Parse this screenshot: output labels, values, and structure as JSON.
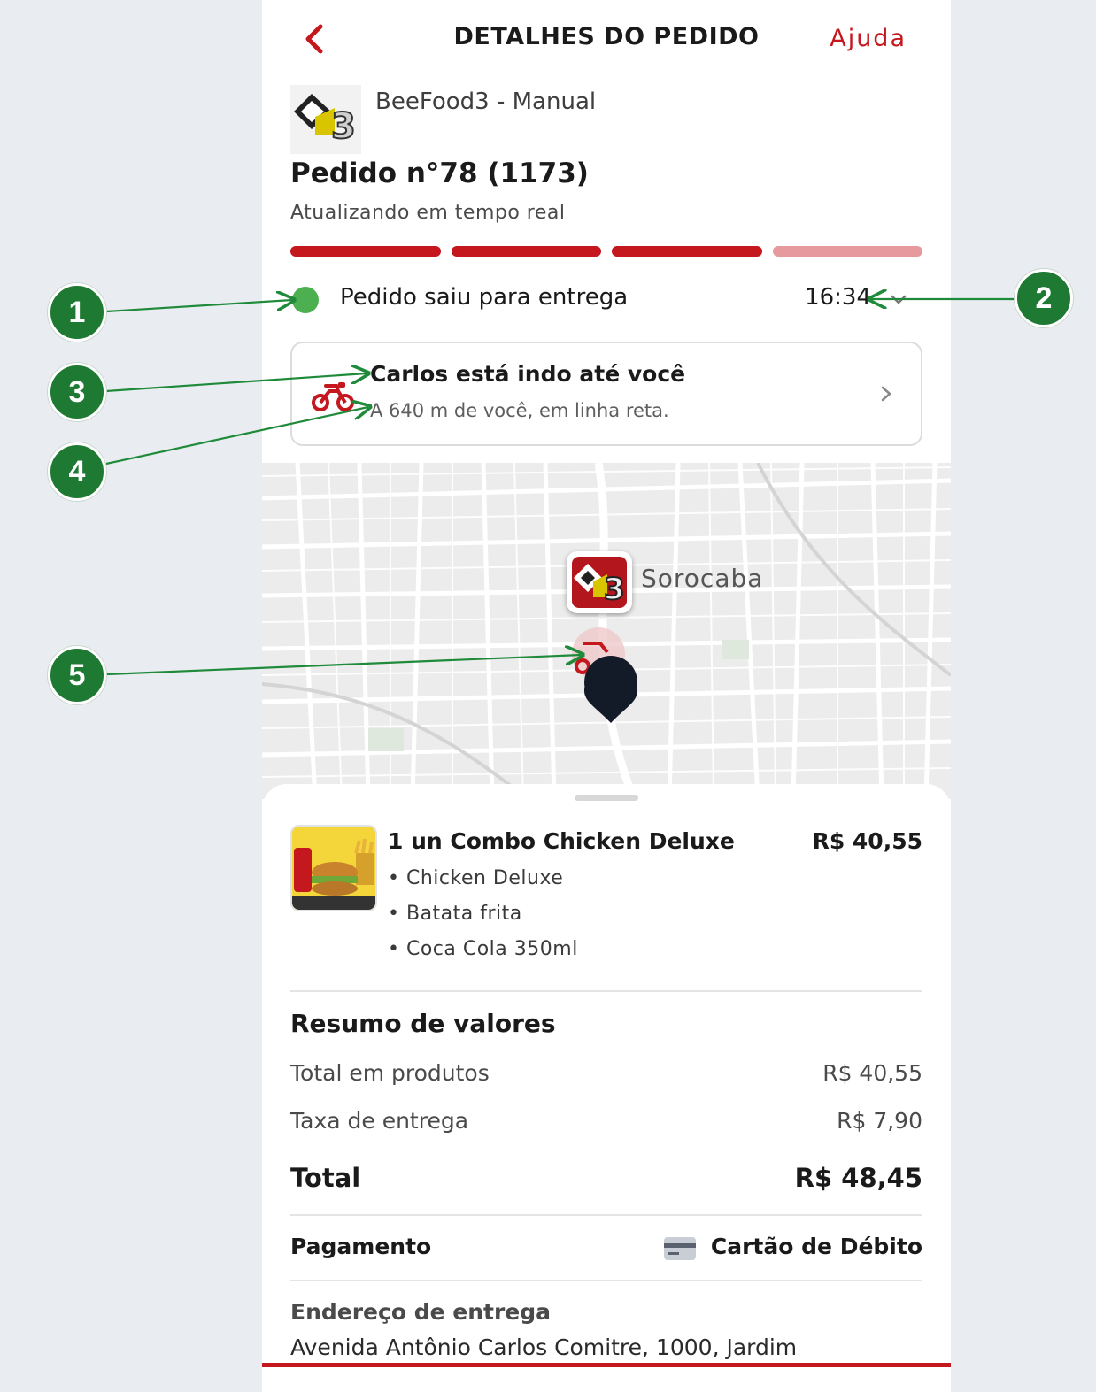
{
  "header": {
    "title": "DETALHES DO PEDIDO",
    "help": "Ajuda",
    "back_icon": "chevron-left-icon"
  },
  "store": {
    "name": "BeeFood3 - Manual",
    "logo_icon": "store-logo"
  },
  "order": {
    "title": "Pedido n°78 (1173)",
    "subtitle": "Atualizando em tempo real",
    "progress_steps_done": 3,
    "progress_steps_total": 4
  },
  "status": {
    "text": "Pedido saiu para entrega",
    "time": "16:34",
    "dot_color": "#4caf50"
  },
  "courier": {
    "title": "Carlos está indo até você",
    "distance": "A 640 m de você, em linha reta."
  },
  "map": {
    "city": "Sorocaba"
  },
  "item": {
    "title": "1 un Combo Chicken Deluxe",
    "price": "R$ 40,55",
    "components": [
      "• Chicken Deluxe",
      "• Batata frita",
      "• Coca Cola 350ml"
    ]
  },
  "summary": {
    "title": "Resumo de valores",
    "products_label": "Total em produtos",
    "products_value": "R$ 40,55",
    "delivery_label": "Taxa de entrega",
    "delivery_value": "R$ 7,90",
    "total_label": "Total",
    "total_value": "R$ 48,45"
  },
  "payment": {
    "label": "Pagamento",
    "method": "Cartão de Débito"
  },
  "address": {
    "label": "Endereço de entrega",
    "text": "Avenida Antônio Carlos Comitre, 1000, Jardim"
  },
  "annotations": [
    "1",
    "2",
    "3",
    "4",
    "5"
  ],
  "colors": {
    "brand_red": "#c4171e",
    "progress_pending": "#e69a9d",
    "annotation_green": "#1e7a33"
  }
}
